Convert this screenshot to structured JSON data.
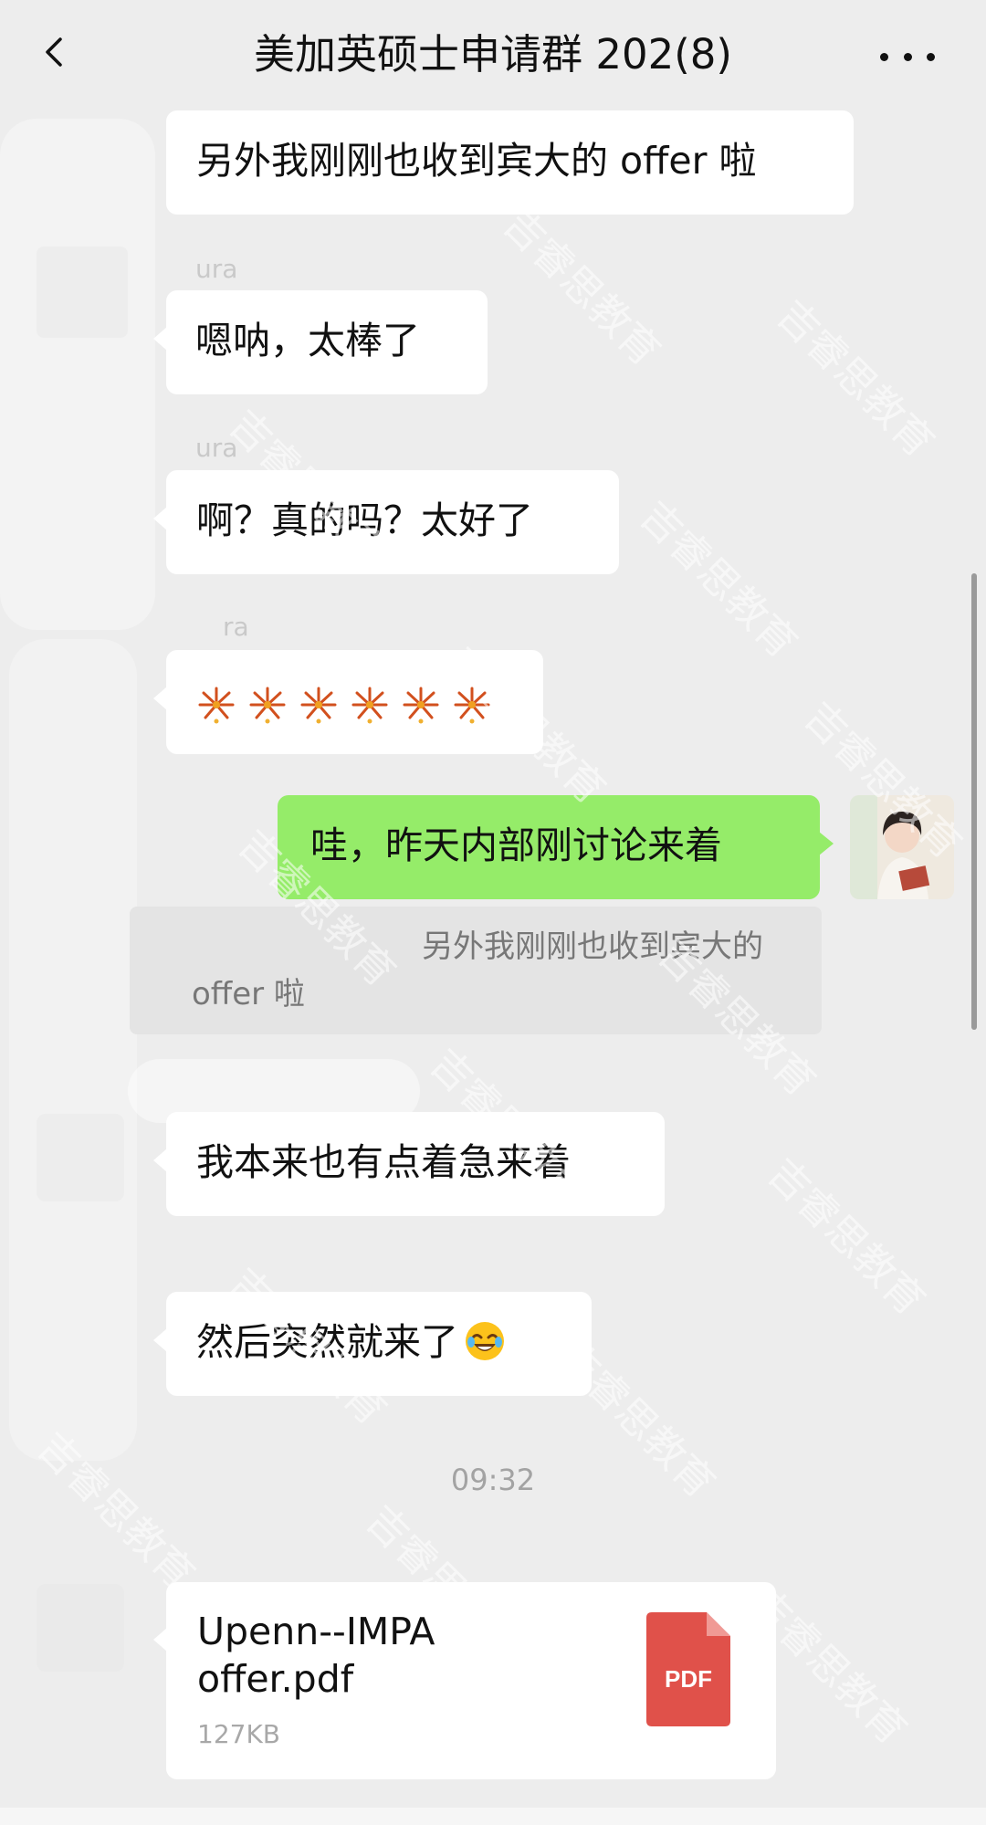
{
  "header": {
    "title": "美加英硕士申请群 202(8)",
    "back_icon": "chevron-left-icon",
    "more_icon": "more-dots-icon"
  },
  "messages": [
    {
      "text": "另外我刚刚也收到宾大的 offer 啦"
    },
    {
      "sender": "ura",
      "text": "嗯呐，太棒了"
    },
    {
      "sender": "ura",
      "text": "啊？真的吗？太好了"
    },
    {
      "sender": "ra",
      "text": "🎆🎆🎆🎆🎆🎆",
      "icon": "firework-emoji"
    },
    {
      "self": true,
      "text": "哇，昨天内部刚讨论来着"
    },
    {
      "text": "我本来也有点着急来着"
    },
    {
      "text": "然后突然就来了",
      "icon": "laughing-emoji"
    }
  ],
  "quote": {
    "line1": "另外我刚刚也收到宾大的",
    "line2": "offer 啦"
  },
  "timestamp": "09:32",
  "file": {
    "name": "Upenn--IMPA\noffer.pdf",
    "size": "127KB",
    "badge": "PDF",
    "icon": "pdf-file-icon"
  },
  "watermark": "吉睿思教育",
  "colors": {
    "background": "#ededed",
    "bubble_other": "#ffffff",
    "bubble_self": "#95ec69",
    "pdf_red": "#e0514a"
  }
}
